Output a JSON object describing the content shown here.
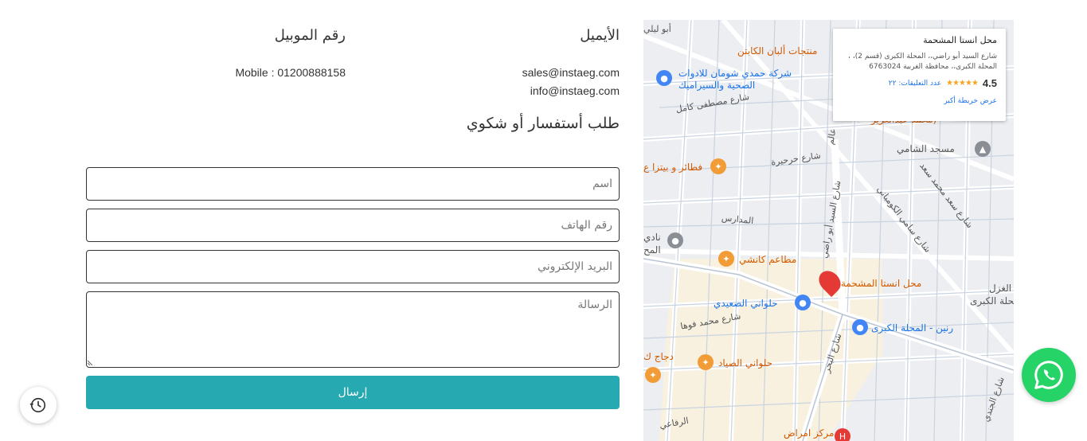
{
  "contact": {
    "email_heading": "الأيميل",
    "mobile_heading": "رقم الموبيل",
    "emails": [
      "sales@instaeg.com",
      "info@instaeg.com"
    ],
    "mobile": "Mobile : 01200888158"
  },
  "form": {
    "title": "طلب أستفسار أو شكوي",
    "name_placeholder": "اسم",
    "phone_placeholder": "رقم الهاتف",
    "email_placeholder": "البريد الإلكتروني",
    "message_placeholder": "الرسالة",
    "submit_label": "إرسال"
  },
  "map": {
    "card": {
      "title": "محل انستا المشحمة",
      "address": "شارع السيد أبو راضي،، المحلة الكبرى (قسم 2)، ، المحلة الكبرى،، محافظة الغربية 6763024",
      "rating": "4.5",
      "stars": "★★★★★",
      "reviews": "عدد التعليقات: ٢٢",
      "view_larger": "عرض خريطة أكبر"
    },
    "places": {
      "alkan": "منتجات ألبان الكابتن",
      "hamdy": "شركة حمدي شومان للادوات",
      "hamdy2": "الصحية والسيراميك",
      "fatayer": "فطائر و بيتزا ع",
      "mosque": "مسجد الشامي",
      "kanchi": "مطاعم كانشي",
      "instaPin": "محل انستا المشحمة",
      "saidi": "حلواني الصعيدي",
      "rnin": "رنين - المحلة الكبرى",
      "sayad": "حلواني الصياد",
      "dajaj": "دجاج ك",
      "marakez": "مركز امراض",
      "nadi": "نادي",
      "mahal": "المح",
      "ghazl": "الغزل",
      "mahalla": "لمحلة الكبرى",
      "abu": "أبو ليلي",
      "mohamed": "(محمد عبدالعزيز"
    },
    "streets": {
      "mostafa": "شارع مصطفى كامل",
      "harhira": "شارع حرحيرة",
      "madares": "المدارس",
      "sayed": "شارع السيد أبو راضي",
      "samy": "شارع سامي الكومباني",
      "saad": "شارع سعد محمد سعد",
      "fouha": "شارع محمد فوها",
      "bahr": "شارع البحر",
      "gendi": "شارع الجندي",
      "rifaai": "الرفاعي",
      "alam": "عالم"
    }
  }
}
